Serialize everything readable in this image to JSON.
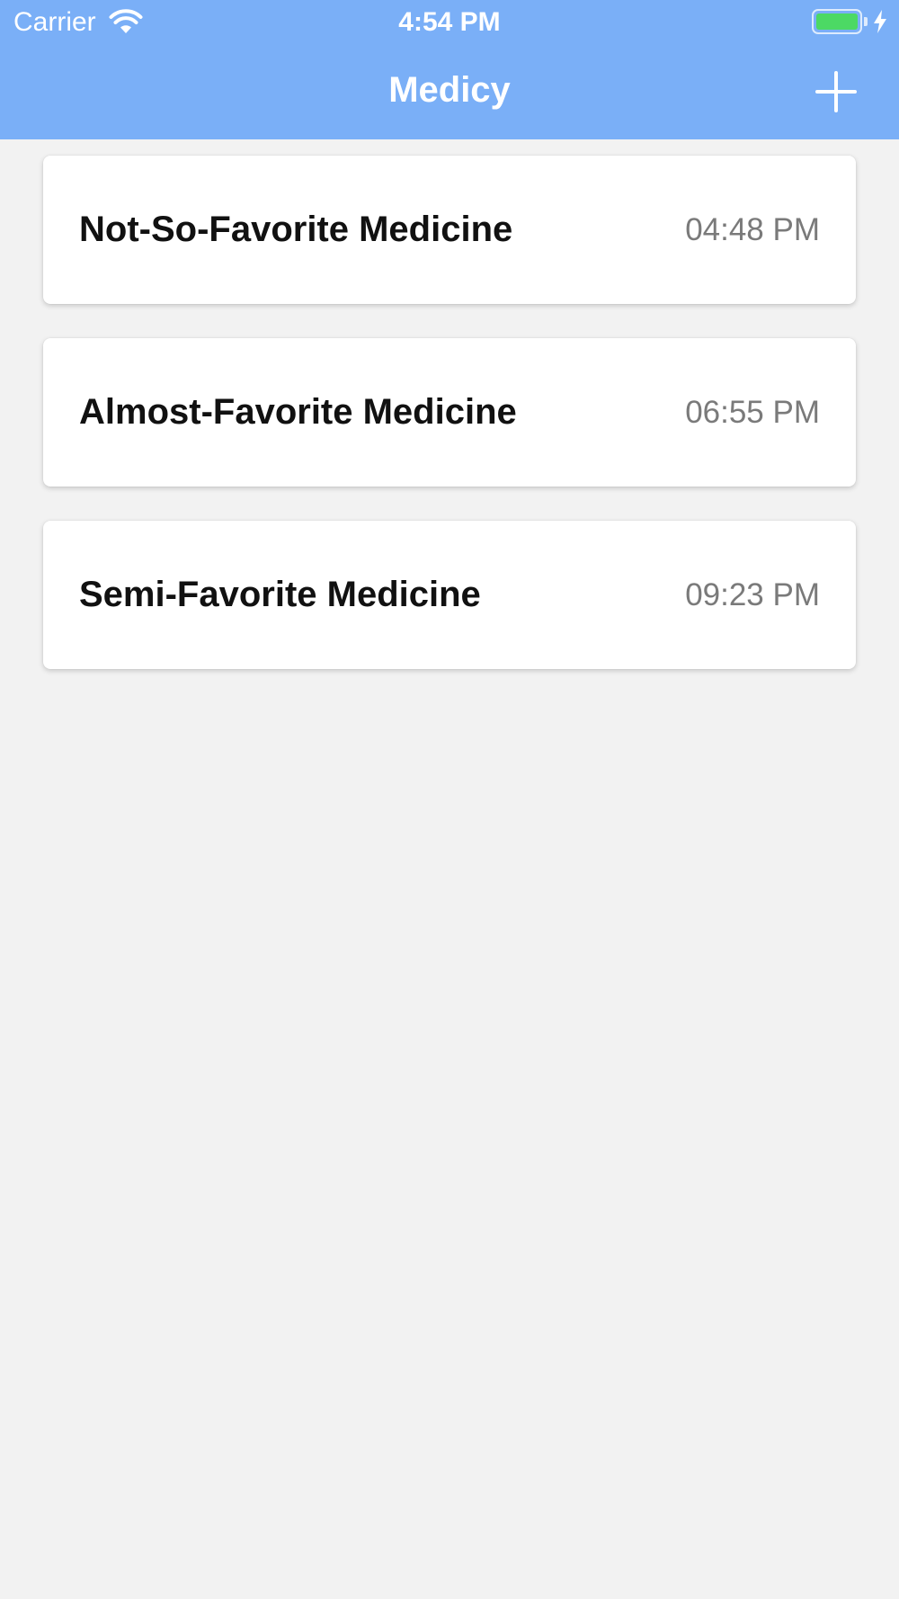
{
  "status_bar": {
    "carrier": "Carrier",
    "time": "4:54 PM",
    "icons": [
      "wifi-icon",
      "battery-icon",
      "charging-bolt-icon"
    ]
  },
  "nav": {
    "title": "Medicy",
    "add_icon": "plus-icon"
  },
  "medicines": [
    {
      "name": "Not-So-Favorite Medicine",
      "time": "04:48 PM"
    },
    {
      "name": "Almost-Favorite Medicine",
      "time": "06:55 PM"
    },
    {
      "name": "Semi-Favorite Medicine",
      "time": "09:23 PM"
    }
  ],
  "colors": {
    "header": "#7aaff7",
    "background": "#f2f2f2",
    "card": "#ffffff",
    "battery": "#4cd964",
    "time_text": "#7a7a7a"
  }
}
